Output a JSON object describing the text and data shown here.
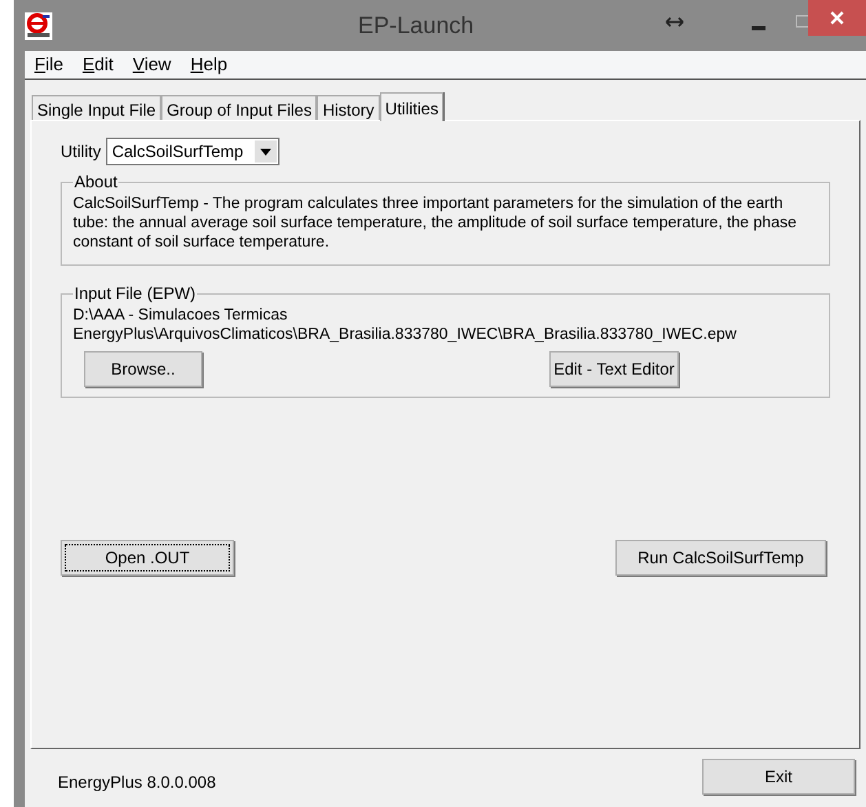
{
  "window": {
    "title": "EP-Launch"
  },
  "menu": [
    {
      "label": "File"
    },
    {
      "label": "Edit"
    },
    {
      "label": "View"
    },
    {
      "label": "Help"
    }
  ],
  "tabs": [
    {
      "label": "Single Input File",
      "selected": false
    },
    {
      "label": "Group of Input Files",
      "selected": false
    },
    {
      "label": "History",
      "selected": false
    },
    {
      "label": "Utilities",
      "selected": true
    }
  ],
  "utility": {
    "label": "Utility",
    "value": "CalcSoilSurfTemp"
  },
  "about": {
    "title": "About",
    "text": "CalcSoilSurfTemp - The program calculates three important parameters for the simulation of the earth tube: the annual average soil surface temperature, the amplitude of soil surface temperature, the phase constant of soil surface temperature."
  },
  "input_file": {
    "title": "Input File (EPW)",
    "path": "D:\\AAA - Simulacoes Termicas EnergyPlus\\ArquivosClimaticos\\BRA_Brasilia.833780_IWEC\\BRA_Brasilia.833780_IWEC.epw",
    "browse_button": "Browse..",
    "edit_button": "Edit - Text Editor"
  },
  "open_button": {
    "label": "Open .OUT",
    "focused": true
  },
  "run_button": {
    "label": "Run CalcSoilSurfTemp",
    "focused": false
  },
  "status": {
    "version": "EnergyPlus 8.0.0.008"
  },
  "exit_button": "Exit"
}
